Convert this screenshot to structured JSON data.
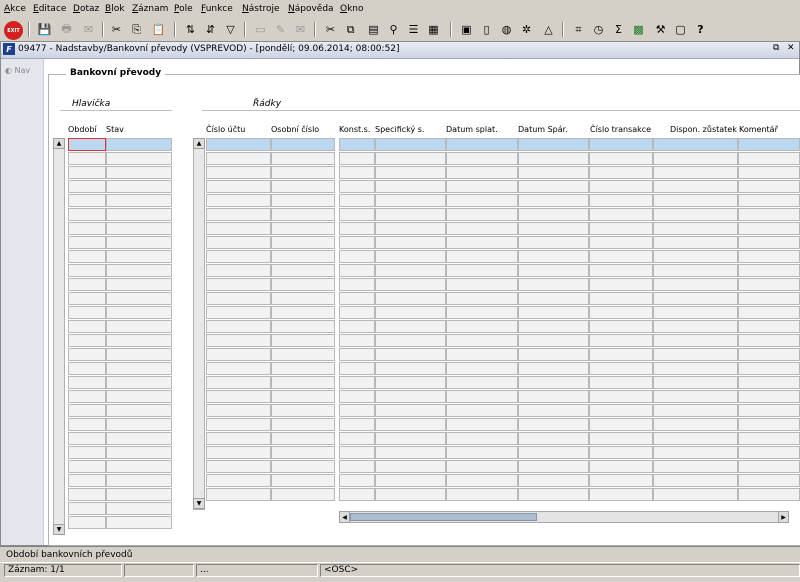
{
  "menu": [
    "Akce",
    "Editace",
    "Dotaz",
    "Blok",
    "Záznam",
    "Pole",
    "Funkce",
    "Nástroje",
    "Nápověda",
    "Okno"
  ],
  "toolbar": {
    "exit_label": "EXIT",
    "buttons": [
      {
        "icon": "save-icon",
        "glyph": "💾",
        "enabled": false
      },
      {
        "icon": "print-icon",
        "glyph": "🖶",
        "enabled": false
      },
      {
        "icon": "mail-icon",
        "glyph": "✉",
        "enabled": false
      },
      {
        "icon": "cut-icon",
        "glyph": "✂",
        "enabled": true
      },
      {
        "icon": "copy-icon",
        "glyph": "⎘",
        "enabled": true
      },
      {
        "icon": "paste-icon",
        "glyph": "📋",
        "enabled": true
      },
      {
        "icon": "sort-asc-icon",
        "glyph": "⇅",
        "enabled": true
      },
      {
        "icon": "sort-desc-icon",
        "glyph": "⇵",
        "enabled": true
      },
      {
        "icon": "filter-icon",
        "glyph": "▽",
        "enabled": true
      },
      {
        "icon": "sum-icon",
        "glyph": "Σ",
        "enabled": true
      },
      {
        "icon": "help-icon",
        "glyph": "?",
        "enabled": true
      }
    ]
  },
  "window": {
    "title": "09477 - Nadstavby/Bankovní převody (VSPREVOD) - [pondělí; 09.06.2014; 08:00:52]",
    "app_icon": "F",
    "restore_glyph": "⧉",
    "close_glyph": "✕"
  },
  "nav": {
    "label": "Nav"
  },
  "form": {
    "title": "Bankovní převody",
    "header_section": {
      "title": "Hlavička",
      "columns": [
        "Období",
        "Stav"
      ]
    },
    "rows_section": {
      "title": "Řádky",
      "columns": [
        "Číslo účtu",
        "Osobní číslo",
        "Konst.s.",
        "Specifický s.",
        "Datum splat.",
        "Datum Spár.",
        "Číslo transakce",
        "Dispon. zůstatek",
        "Komentář"
      ]
    }
  },
  "status": {
    "message": "Období bankovních převodů",
    "record": "Záznam: 1/1",
    "field2": "...",
    "mode": "<OSC>"
  }
}
